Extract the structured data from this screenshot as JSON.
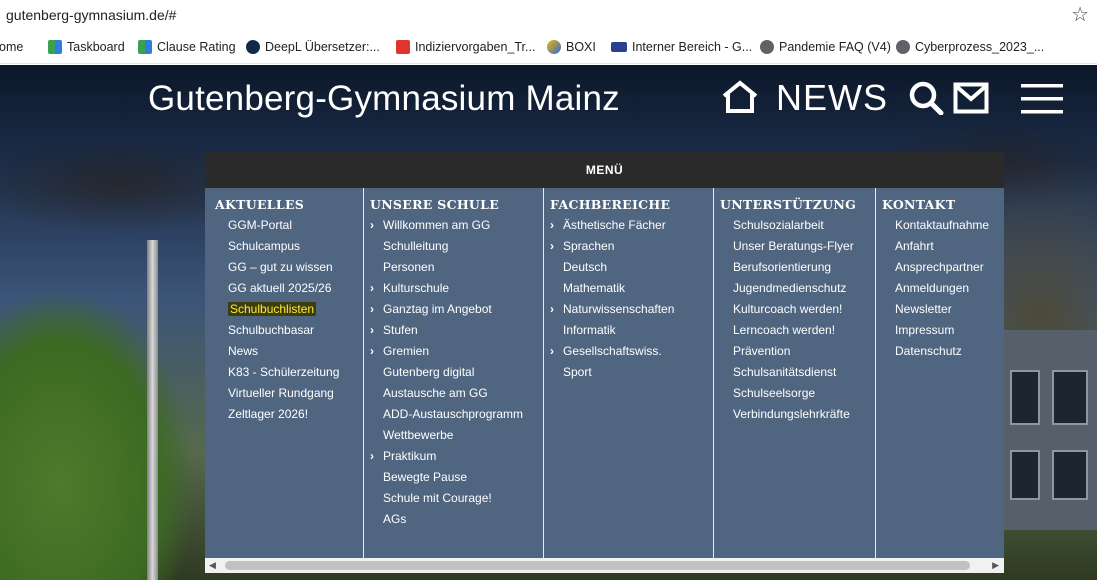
{
  "browser": {
    "url": "gutenberg-gymnasium.de/#",
    "bookmarks": [
      {
        "label": "Home",
        "icon": "home-icon"
      },
      {
        "label": "Taskboard",
        "icon": "grid-icon"
      },
      {
        "label": "Clause Rating",
        "icon": "grid-icon"
      },
      {
        "label": "DeepL Übersetzer:...",
        "icon": "deepl-icon"
      },
      {
        "label": "Indiziervorgaben_Tr...",
        "icon": "pdf-icon"
      },
      {
        "label": "BOXI",
        "icon": "boxi-icon"
      },
      {
        "label": "Interner Bereich - G...",
        "icon": "inw-icon"
      },
      {
        "label": "Pandemie FAQ (V4)",
        "icon": "globe-icon"
      },
      {
        "label": "Cyberprozess_2023_...",
        "icon": "globe-icon"
      }
    ]
  },
  "site": {
    "title": "Gutenberg-Gymnasium Mainz",
    "news": "NEWS"
  },
  "menu": {
    "heading": "MENÜ",
    "columns": [
      {
        "title": "AKTUELLES",
        "items": [
          {
            "label": "GGM-Portal",
            "arrow": ""
          },
          {
            "label": "Schulcampus",
            "arrow": ""
          },
          {
            "label": "GG – gut zu wissen",
            "arrow": ""
          },
          {
            "label": "GG aktuell 2025/26",
            "arrow": ""
          },
          {
            "label": "Schulbuchlisten",
            "arrow": ""
          },
          {
            "label": "Schulbuchbasar",
            "arrow": ""
          },
          {
            "label": "News",
            "arrow": ""
          },
          {
            "label": "K83 - Schülerzeitung",
            "arrow": ""
          },
          {
            "label": "Virtueller Rundgang",
            "arrow": ""
          },
          {
            "label": "Zeltlager 2026!",
            "arrow": ""
          }
        ]
      },
      {
        "title": "UNSERE SCHULE",
        "items": [
          {
            "label": "Willkommen am GG",
            "arrow": "›"
          },
          {
            "label": "Schulleitung",
            "arrow": ""
          },
          {
            "label": "Personen",
            "arrow": ""
          },
          {
            "label": "Kulturschule",
            "arrow": "›"
          },
          {
            "label": "Ganztag im Angebot",
            "arrow": "›"
          },
          {
            "label": "Stufen",
            "arrow": "›"
          },
          {
            "label": "Gremien",
            "arrow": "›"
          },
          {
            "label": "Gutenberg digital",
            "arrow": ""
          },
          {
            "label": "Austausche am GG",
            "arrow": ""
          },
          {
            "label": "ADD-Austauschprogramm",
            "arrow": ""
          },
          {
            "label": "Wettbewerbe",
            "arrow": ""
          },
          {
            "label": "Praktikum",
            "arrow": "›"
          },
          {
            "label": "Bewegte Pause",
            "arrow": ""
          },
          {
            "label": "Schule mit Courage!",
            "arrow": ""
          },
          {
            "label": "AGs",
            "arrow": ""
          }
        ]
      },
      {
        "title": "FACHBEREICHE",
        "items": [
          {
            "label": "Ästhetische Fächer",
            "arrow": "›"
          },
          {
            "label": "Sprachen",
            "arrow": "›"
          },
          {
            "label": "Deutsch",
            "arrow": ""
          },
          {
            "label": "Mathematik",
            "arrow": ""
          },
          {
            "label": "Naturwissenschaften",
            "arrow": "›"
          },
          {
            "label": "Informatik",
            "arrow": ""
          },
          {
            "label": "Gesellschaftswiss.",
            "arrow": "›"
          },
          {
            "label": "Sport",
            "arrow": ""
          }
        ]
      },
      {
        "title": "UNTERSTÜTZUNG",
        "items": [
          {
            "label": "Schulsozialarbeit",
            "arrow": ""
          },
          {
            "label": "Unser Beratungs-Flyer",
            "arrow": ""
          },
          {
            "label": "Berufsorientierung",
            "arrow": ""
          },
          {
            "label": "Jugendmedienschutz",
            "arrow": ""
          },
          {
            "label": "Kulturcoach werden!",
            "arrow": ""
          },
          {
            "label": "Lerncoach werden!",
            "arrow": ""
          },
          {
            "label": "Prävention",
            "arrow": ""
          },
          {
            "label": "Schulsanitätsdienst",
            "arrow": ""
          },
          {
            "label": "Schulseelsorge",
            "arrow": ""
          },
          {
            "label": "Verbindungslehrkräfte",
            "arrow": ""
          }
        ]
      },
      {
        "title": "KONTAKT",
        "items": [
          {
            "label": "Kontaktaufnahme",
            "arrow": ""
          },
          {
            "label": "Anfahrt",
            "arrow": ""
          },
          {
            "label": "Ansprechpartner",
            "arrow": ""
          },
          {
            "label": "Anmeldungen",
            "arrow": ""
          },
          {
            "label": "Newsletter",
            "arrow": ""
          },
          {
            "label": "Impressum",
            "arrow": ""
          },
          {
            "label": "Datenschutz",
            "arrow": ""
          }
        ]
      }
    ],
    "highlighted_item": "Schulbuchlisten"
  },
  "colors": {
    "menu_bg": "#4f6580",
    "menu_header_bg": "#2a2a2a",
    "highlight_text": "#ffeb3b"
  }
}
